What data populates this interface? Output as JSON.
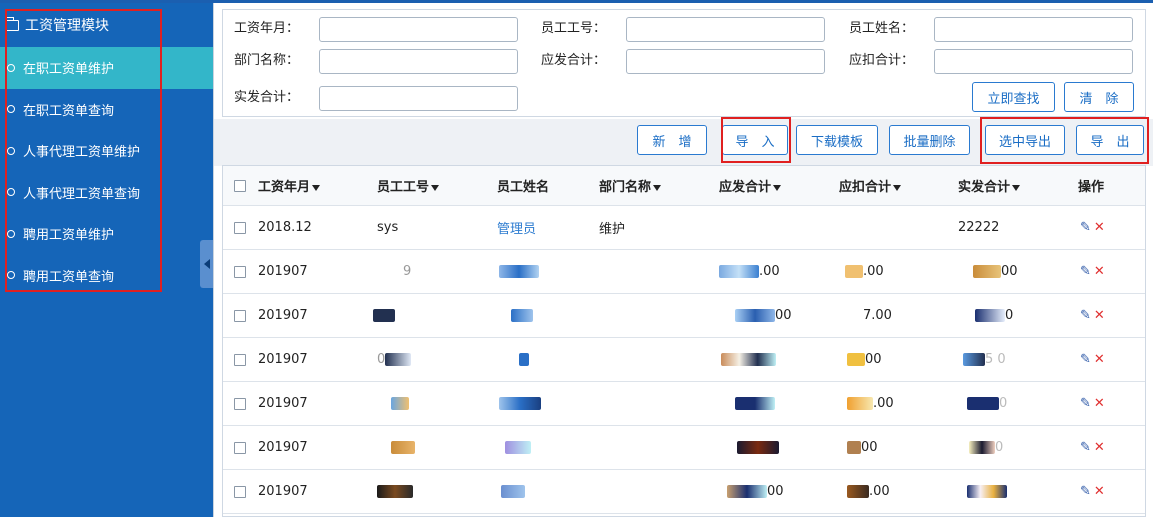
{
  "sidebar": {
    "title": "工资管理模块",
    "items": [
      {
        "label": "在职工资单维护",
        "active": true
      },
      {
        "label": "在职工资单查询",
        "active": false
      },
      {
        "label": "人事代理工资单维护",
        "active": false
      },
      {
        "label": "人事代理工资单查询",
        "active": false
      },
      {
        "label": "聘用工资单维护",
        "active": false
      },
      {
        "label": "聘用工资单查询",
        "active": false
      }
    ]
  },
  "search": {
    "salary_month_label": "工资年月：",
    "emp_no_label": "员工工号：",
    "emp_name_label": "员工姓名：",
    "dept_label": "部门名称：",
    "gross_label": "应发合计：",
    "deduct_label": "应扣合计：",
    "net_label": "实发合计：",
    "search_btn": "立即查找",
    "clear_btn": "清　除"
  },
  "toolbar": {
    "add": "新　增",
    "import": "导　入",
    "download_template": "下载模板",
    "batch_delete": "批量删除",
    "export_selected": "选中导出",
    "export": "导　出"
  },
  "table": {
    "headers": {
      "month": "工资年月",
      "emp_no": "员工工号",
      "emp_name": "员工姓名",
      "dept": "部门名称",
      "gross": "应发合计",
      "deduct": "应扣合计",
      "net": "实发合计",
      "ops": "操作"
    },
    "rows": [
      {
        "month": "2018.12",
        "emp_no": "sys",
        "emp_name": "管理员",
        "dept": "维护",
        "gross": "",
        "deduct": "",
        "net": "22222"
      },
      {
        "month": "201907",
        "emp_no": "9",
        "emp_name": "",
        "dept": "",
        "gross": ".00",
        "deduct": ".00",
        "net": "00"
      },
      {
        "month": "201907",
        "emp_no": "",
        "emp_name": "",
        "dept": "",
        "gross": "00",
        "deduct": "7.00",
        "net": "0"
      },
      {
        "month": "201907",
        "emp_no": "0",
        "emp_name": "",
        "dept": "",
        "gross": "",
        "deduct": "00",
        "net": "5 0"
      },
      {
        "month": "201907",
        "emp_no": "",
        "emp_name": "",
        "dept": "",
        "gross": "",
        "deduct": ".00",
        "net": "0"
      },
      {
        "month": "201907",
        "emp_no": "",
        "emp_name": "",
        "dept": "",
        "gross": "",
        "deduct": "00",
        "net": "0"
      },
      {
        "month": "201907",
        "emp_no": "",
        "emp_name": "",
        "dept": "",
        "gross": "00",
        "deduct": ".00",
        "net": ""
      }
    ],
    "edit_icon": "✎",
    "delete_icon": "✕"
  }
}
